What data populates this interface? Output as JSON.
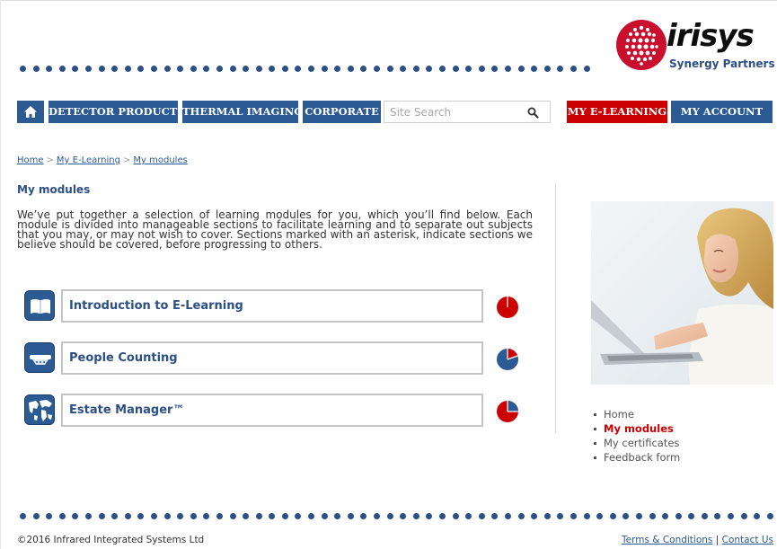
{
  "logo": {
    "wordmark": "irisys",
    "tagline": "Synergy Partners"
  },
  "nav": {
    "home_icon": "home-icon",
    "items": [
      "DETECTOR PRODUCTS",
      "THERMAL IMAGING",
      "CORPORATE"
    ],
    "search_placeholder": "Site Search",
    "search_icon": "search-icon",
    "elearning": "MY E-LEARNING",
    "account": "MY ACCOUNT"
  },
  "breadcrumb": [
    "Home",
    "My E-Learning",
    "My modules"
  ],
  "breadcrumb_separator": ">",
  "page": {
    "title": "My modules",
    "intro": "We’ve put together a selection of learning modules for you, which you’ll find below. Each module is divided into manageable sections to facilitate learning and to separate out subjects that you may, or may not wish to cover. Sections marked with an asterisk, indicate sections we believe should be covered, before progressing to others."
  },
  "modules": [
    {
      "title": "Introduction to E-Learning",
      "icon": "book-icon",
      "progress_fraction": 0.25,
      "pie_color": "#cc0000"
    },
    {
      "title": "People Counting",
      "icon": "people-counter-sensor-icon",
      "progress_fraction": 0.25,
      "pie_color": "#2c5a93"
    },
    {
      "title": "Estate Manager™",
      "icon": "world-map-icon",
      "progress_fraction": 0.25,
      "pie_color": "#cc0000"
    }
  ],
  "side_nav": [
    {
      "label": "Home",
      "active": false
    },
    {
      "label": "My modules",
      "active": true
    },
    {
      "label": "My certificates",
      "active": false
    },
    {
      "label": "Feedback form",
      "active": false
    }
  ],
  "footer": {
    "copyright": "©2016 Infrared Integrated Systems Ltd",
    "terms": "Terms & Conditions",
    "separator": "|",
    "contact": "Contact Us"
  },
  "colors": {
    "brand_blue": "#2c5a93",
    "brand_red": "#cc0000",
    "heading_blue": "#2c4f86"
  }
}
